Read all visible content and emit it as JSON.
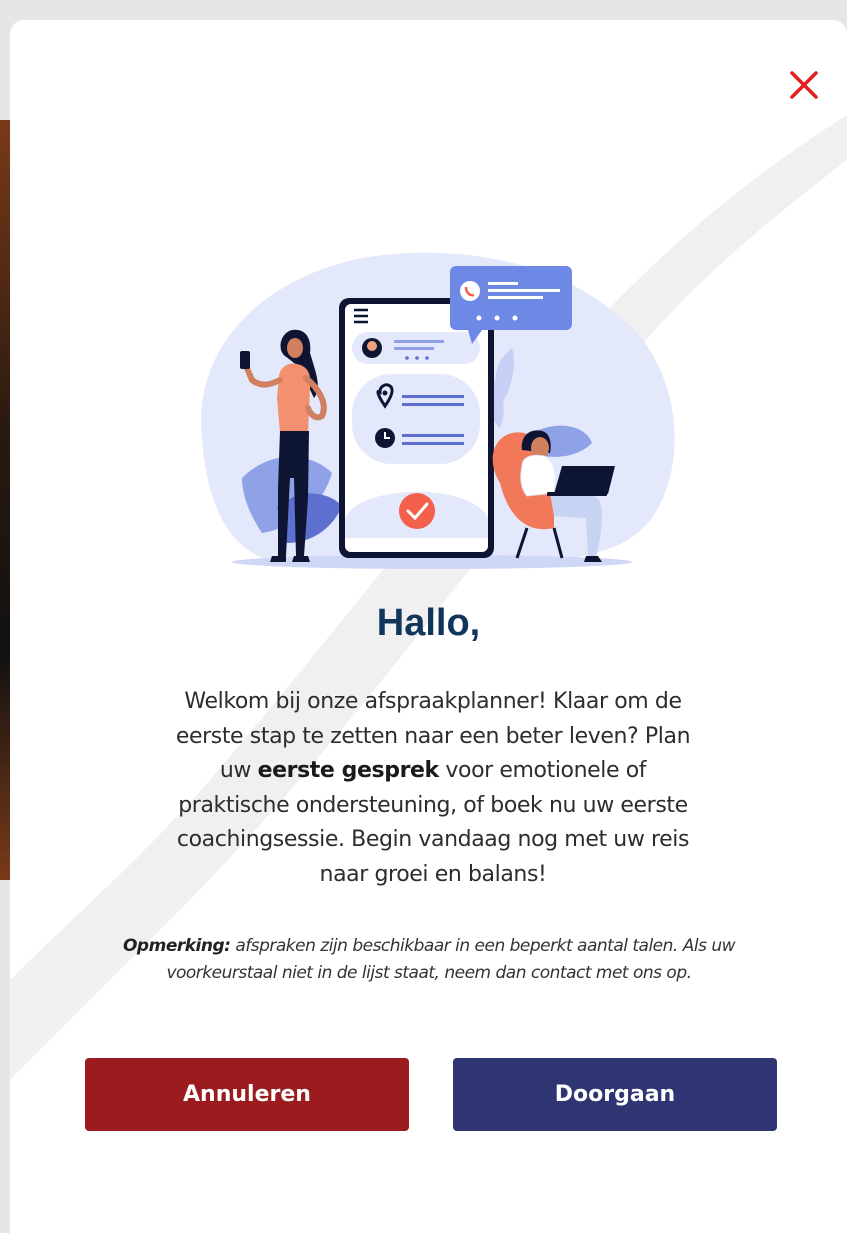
{
  "dialog": {
    "close_icon": "close-icon",
    "title": "Hallo,",
    "intro_before": "Welkom bij onze afspraakplanner! Klaar om de eerste stap te zetten naar een beter leven? Plan uw ",
    "intro_bold": "eerste gesprek",
    "intro_after": " voor emotionele of praktische ondersteuning, of boek nu uw eerste coachingsessie. Begin vandaag nog met uw reis naar groei en balans!",
    "note_label": "Opmerking:",
    "note_text": " afspraken zijn beschikbaar in een beperkt aantal talen. Als uw voorkeurstaal niet in de lijst staat, neem dan contact met ons op.",
    "illustration": "appointment-booking-illustration"
  },
  "buttons": {
    "cancel_label": "Annuleren",
    "continue_label": "Doorgaan"
  },
  "colors": {
    "title": "#12355b",
    "cancel": "#9b1b1f",
    "continue": "#2e3572",
    "close": "#e02020"
  }
}
